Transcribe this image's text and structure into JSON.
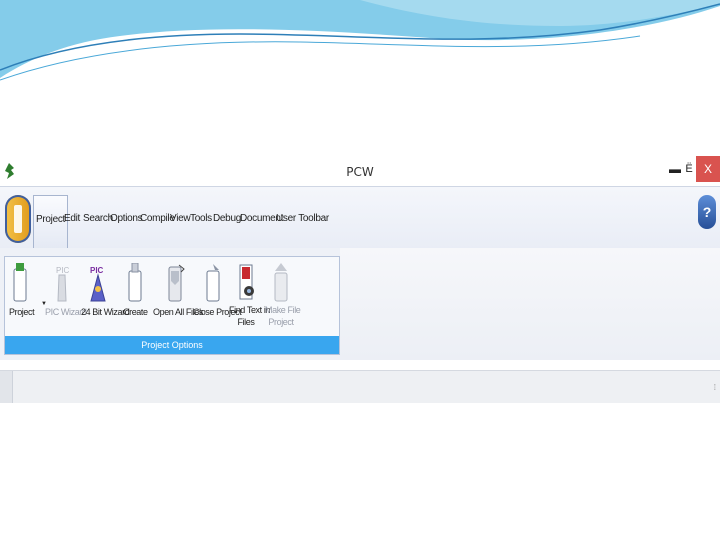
{
  "window": {
    "title": "PCW"
  },
  "window_controls": {
    "minimize": "▬",
    "maximize": "Ё",
    "close": "X"
  },
  "menu": {
    "tabs": [
      {
        "label": "Project"
      },
      {
        "label": "Edit"
      },
      {
        "label": "Search"
      },
      {
        "label": "Options"
      },
      {
        "label": "Compile"
      },
      {
        "label": "View"
      },
      {
        "label": "Tools"
      },
      {
        "label": "Debug"
      },
      {
        "label": "Document"
      },
      {
        "label": "User Toolbar"
      }
    ],
    "active_tab": "Project",
    "help": "?"
  },
  "ribbon": {
    "group_label": "Project Options",
    "buttons": [
      {
        "label": "Project",
        "icon": "project-icon",
        "enabled": true
      },
      {
        "label": "PIC Wizard",
        "icon": "pic-wizard-icon",
        "enabled": false
      },
      {
        "label": "24 Bit Wizard",
        "icon": "24bit-wizard-icon",
        "enabled": true
      },
      {
        "label": "Create",
        "icon": "create-icon",
        "enabled": true
      },
      {
        "label": "Open All Files",
        "icon": "open-all-files-icon",
        "enabled": true
      },
      {
        "label": "Close Project",
        "icon": "close-project-icon",
        "enabled": true
      },
      {
        "label": "Find Text in Files",
        "label_line1": "Find Text in",
        "label_line2": "Files",
        "icon": "find-text-icon",
        "enabled": true
      },
      {
        "label": "Make File Project",
        "label_line1": "Make File",
        "label_line2": "Project",
        "icon": "make-file-project-icon",
        "enabled": false
      }
    ]
  },
  "colors": {
    "accent": "#39a6ef",
    "close": "#d9534f",
    "ribbon_bg": "#eef1f7"
  }
}
